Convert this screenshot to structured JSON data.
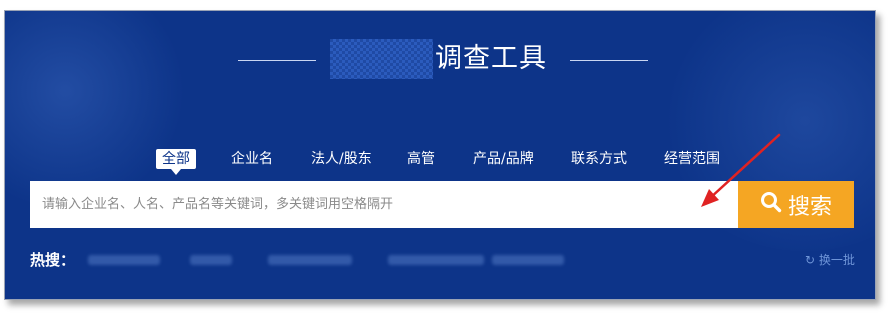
{
  "header": {
    "title_suffix": "调查工具"
  },
  "tabs": [
    {
      "label": "全部",
      "active": true
    },
    {
      "label": "企业名",
      "active": false
    },
    {
      "label": "法人/股东",
      "active": false
    },
    {
      "label": "高管",
      "active": false
    },
    {
      "label": "产品/品牌",
      "active": false
    },
    {
      "label": "联系方式",
      "active": false
    },
    {
      "label": "经营范围",
      "active": false
    }
  ],
  "search": {
    "placeholder": "请输入企业名、人名、产品名等关键词，多关键词用空格隔开",
    "button_label": "搜索"
  },
  "hot": {
    "label": "热搜：",
    "refresh_icon": "refresh-icon",
    "refresh_label": "换一批"
  },
  "colors": {
    "background": "#0d3489",
    "accent": "#f5a623",
    "annotation_arrow": "#e02222"
  }
}
